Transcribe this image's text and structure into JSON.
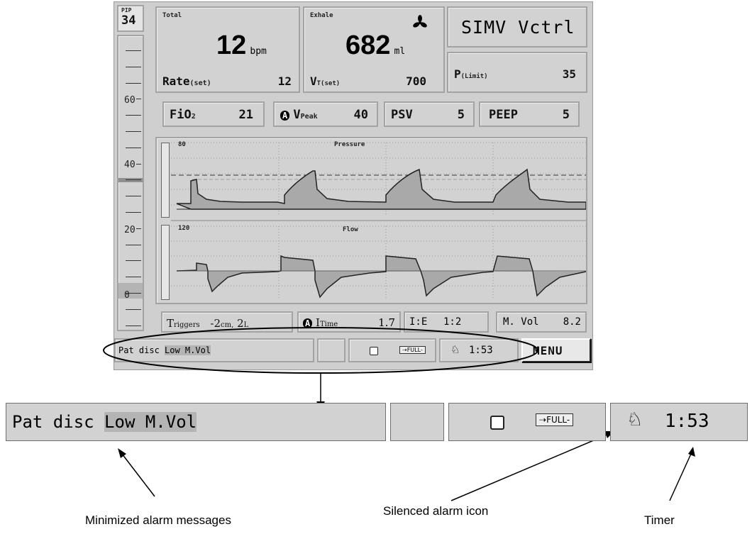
{
  "pip": {
    "label": "PIP",
    "value": "34"
  },
  "scale_labels": [
    "60",
    "40",
    "20",
    "0"
  ],
  "rate": {
    "label": "Total",
    "value": "12",
    "unit": "bpm",
    "set_label": "Rate",
    "set_sub": "(set)",
    "set_value": "12"
  },
  "volume": {
    "label": "Exhale",
    "value": "682",
    "unit": "ml",
    "set_label": "V",
    "set_sub": "T(set)",
    "set_value": "700"
  },
  "mode": "SIMV Vctrl",
  "plimit": {
    "label": "P",
    "sub": "(Limit)",
    "value": "35"
  },
  "fio2": {
    "label": "FiO",
    "sub": "2",
    "value": "21"
  },
  "vpeak": {
    "prefix": "A",
    "label": "V",
    "sub": "Peak",
    "value": "40"
  },
  "psv": {
    "label": "PSV",
    "value": "5"
  },
  "peep": {
    "label": "PEEP",
    "value": "5"
  },
  "pressure_chart": {
    "top_label": "80",
    "title": "Pressure"
  },
  "flow_chart": {
    "top_label": "120",
    "title": "Flow"
  },
  "triggers": {
    "label": "T",
    "sub": "riggers",
    "value": "-2",
    "value_sub": "cm,",
    "value2": "2",
    "value2_sub": "L"
  },
  "itime": {
    "prefix": "A",
    "label": "I",
    "sub": "Time",
    "value": "1.7"
  },
  "ie": {
    "label": "I:E",
    "value": "1:2"
  },
  "mvol": {
    "label": "M. Vol",
    "value": "8.2"
  },
  "alarm_message": {
    "part1": "Pat disc",
    "part2": "Low M.Vol"
  },
  "battery": "FULL",
  "timer": "1:53",
  "menu": "MENU",
  "callouts": {
    "alarm_messages": "Minimized alarm messages",
    "silenced_icon": "Silenced alarm icon",
    "timer": "Timer"
  },
  "colors": {
    "screen": "#cfcfcf",
    "waveform_fill": "#a9a9a9",
    "highlight": "#b4b4b4"
  }
}
